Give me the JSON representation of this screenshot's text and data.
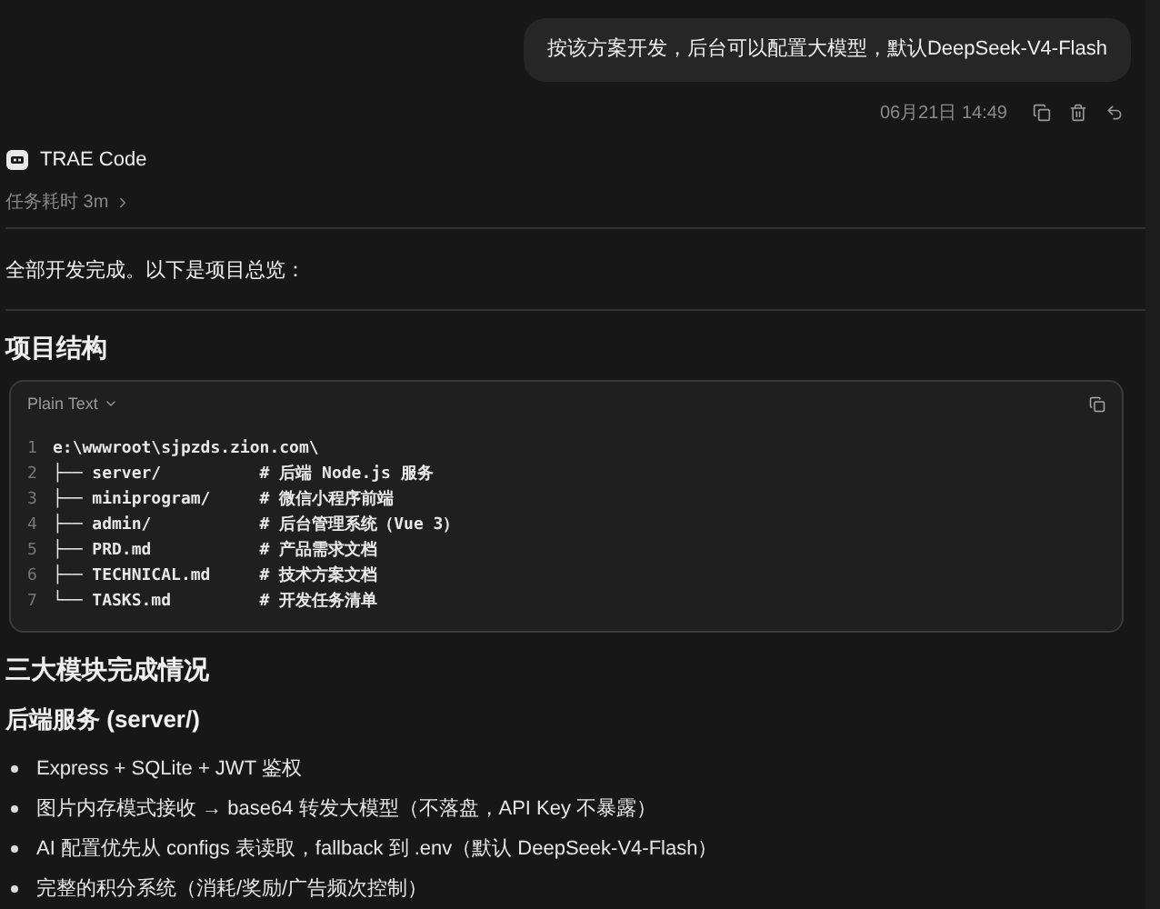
{
  "user_message": {
    "text": "按该方案开发，后台可以配置大模型，默认DeepSeek-V4-Flash",
    "time": "06月21日 14:49"
  },
  "assistant": {
    "name": "TRAE Code",
    "duration": "任务耗时 3m",
    "intro": "全部开发完成。以下是项目总览："
  },
  "sections": [
    {
      "kind": "heading",
      "text": "项目结构"
    },
    {
      "kind": "code",
      "language": "Plain Text",
      "lines": [
        {
          "number": "1",
          "code": "e:\\wwwroot\\sjpzds.zion.com\\"
        },
        {
          "number": "2",
          "code": "├── server/          # 后端 Node.js 服务"
        },
        {
          "number": "3",
          "code": "├── miniprogram/     # 微信小程序前端"
        },
        {
          "number": "4",
          "code": "├── admin/           # 后台管理系统（Vue 3）"
        },
        {
          "number": "5",
          "code": "├── PRD.md           # 产品需求文档"
        },
        {
          "number": "6",
          "code": "├── TECHNICAL.md     # 技术方案文档"
        },
        {
          "number": "7",
          "code": "└── TASKS.md         # 开发任务清单"
        }
      ]
    },
    {
      "kind": "heading",
      "text": "三大模块完成情况"
    },
    {
      "kind": "subheading",
      "text": "后端服务 (server/)"
    },
    {
      "kind": "bullets",
      "items": [
        "Express + SQLite + JWT 鉴权",
        "图片内存模式接收 → base64 转发大模型（不落盘，API Key 不暴露）",
        "AI 配置优先从 configs 表读取，fallback 到 .env（默认 DeepSeek-V4-Flash）",
        "完整的积分系统（消耗/奖励/广告频次控制）"
      ]
    }
  ]
}
